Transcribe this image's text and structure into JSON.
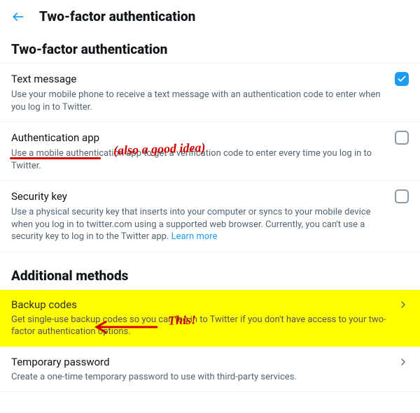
{
  "header": {
    "title": "Two-factor authentication"
  },
  "sections": {
    "twofa": {
      "heading": "Two-factor authentication",
      "options": {
        "text_message": {
          "title": "Text message",
          "desc": "Use your mobile phone to receive a text message with an authentication code to enter when you log in to Twitter.",
          "checked": true
        },
        "auth_app": {
          "title": "Authentication app",
          "desc": "Use a mobile authentication app to get a verification code to enter every time you log in to Twitter.",
          "checked": false
        },
        "security_key": {
          "title": "Security key",
          "desc_part1": "Use a physical security key that inserts into your computer or syncs to your mobile device when you log in to twitter.com using a supported web browser. Currently, you can't use a security key to log in to the Twitter app. ",
          "learn_more": "Learn more",
          "checked": false
        }
      }
    },
    "additional": {
      "heading": "Additional methods",
      "options": {
        "backup_codes": {
          "title": "Backup codes",
          "desc": "Get single-use backup codes so you can log in to Twitter if you don't have access to your two-factor authentication options."
        },
        "temp_password": {
          "title": "Temporary password",
          "desc": "Create a one-time temporary password to use with third-party services."
        }
      }
    }
  },
  "annotations": {
    "auth_app_note": "(also a good idea)",
    "backup_note": "This!"
  }
}
